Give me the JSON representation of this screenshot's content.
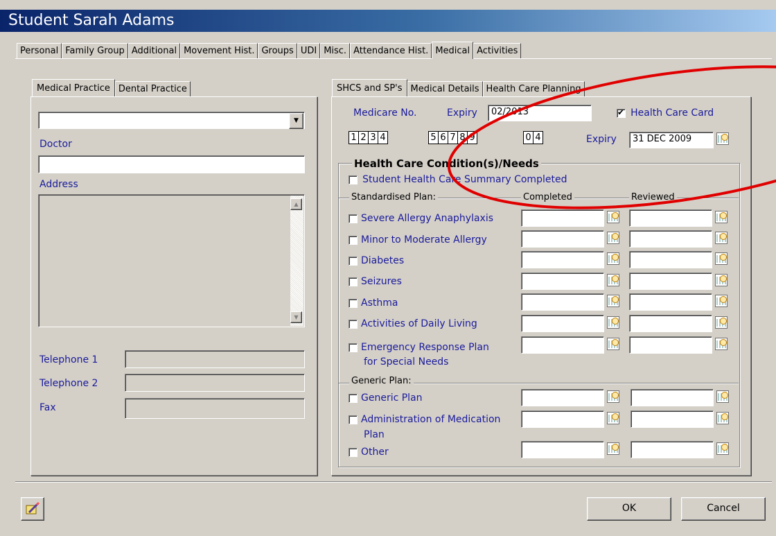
{
  "window": {
    "title": "Student Sarah Adams"
  },
  "main_tabs": [
    "Personal",
    "Family Group",
    "Additional",
    "Movement Hist.",
    "Groups",
    "UDI",
    "Misc.",
    "Attendance Hist.",
    "Medical",
    "Activities"
  ],
  "left_panel": {
    "tabs": [
      "Medical Practice",
      "Dental Practice"
    ],
    "practice_select": "",
    "doctor_label": "Doctor",
    "doctor_value": "",
    "address_label": "Address",
    "telephone1_label": "Telephone 1",
    "telephone2_label": "Telephone 2",
    "fax_label": "Fax"
  },
  "right_panel": {
    "tabs": [
      "SHCS and SP's",
      "Medical Details",
      "Health Care Planning"
    ],
    "medicare_label": "Medicare No.",
    "expiry_label": "Expiry",
    "medicare_expiry": "02/2013",
    "health_care_card_label": "Health Care Card",
    "health_care_card_checked": true,
    "medicare_digits": [
      "1",
      "2",
      "3",
      "4",
      "5",
      "6",
      "7",
      "8",
      "9",
      "0",
      "4"
    ],
    "card_expiry_label": "Expiry",
    "card_expiry": "31 DEC 2009",
    "conditions_title": "Health Care Condition(s)/Needs",
    "summary_completed_label": "Student Health Care Summary Completed",
    "standardised_plan_label": "Standardised Plan:",
    "completed_label": "Completed",
    "reviewed_label": "Reviewed",
    "standardised_items": [
      "Severe Allergy Anaphylaxis",
      "Minor to Moderate Allergy",
      "Diabetes",
      "Seizures",
      "Asthma",
      "Activities of Daily Living",
      "Emergency Response Plan",
      "for Special Needs"
    ],
    "generic_plan_label": "Generic Plan:",
    "generic_items": [
      "Generic Plan",
      "Administration of Medication",
      "Plan",
      "Other"
    ]
  },
  "footer": {
    "ok_label": "OK",
    "cancel_label": "Cancel",
    "notes_icon": "notebook-pencil-icon"
  },
  "annotation": {
    "color": "#e00000"
  }
}
